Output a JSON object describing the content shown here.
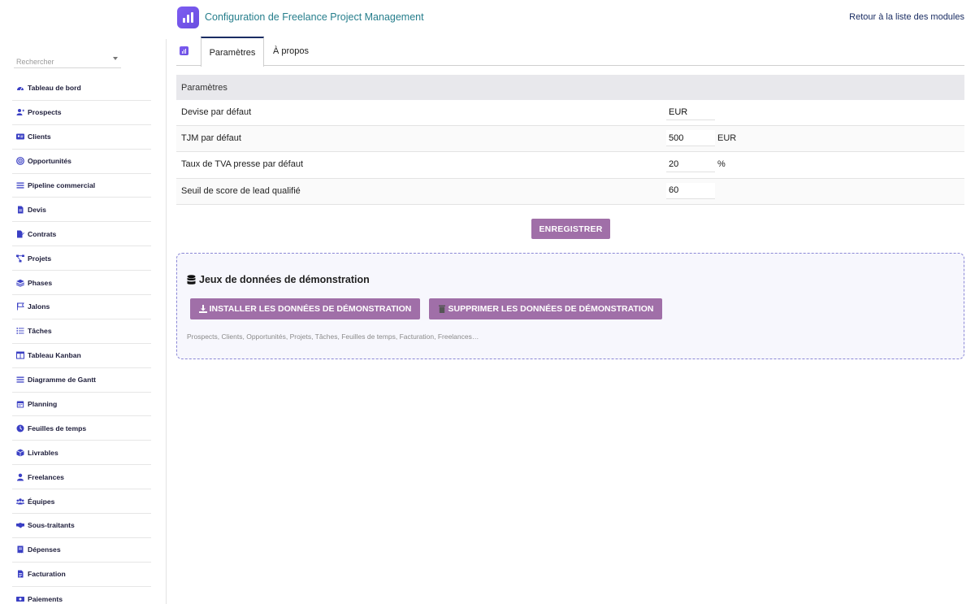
{
  "header": {
    "title": "Configuration de Freelance Project Management",
    "back_link": "Retour à la liste des modules"
  },
  "sidebar": {
    "search_placeholder": "Rechercher",
    "items": [
      {
        "label": "Tableau de bord",
        "icon": "gauge-icon"
      },
      {
        "label": "Prospects",
        "icon": "user-plus-icon"
      },
      {
        "label": "Clients",
        "icon": "id-card-icon"
      },
      {
        "label": "Opportunités",
        "icon": "target-icon"
      },
      {
        "label": "Pipeline commercial",
        "icon": "bars-icon"
      },
      {
        "label": "Devis",
        "icon": "file-icon"
      },
      {
        "label": "Contrats",
        "icon": "file-signature-icon"
      },
      {
        "label": "Projets",
        "icon": "project-diagram-icon"
      },
      {
        "label": "Phases",
        "icon": "layer-group-icon"
      },
      {
        "label": "Jalons",
        "icon": "flag-icon"
      },
      {
        "label": "Tâches",
        "icon": "tasks-icon"
      },
      {
        "label": "Tableau Kanban",
        "icon": "columns-icon"
      },
      {
        "label": "Diagramme de Gantt",
        "icon": "gantt-icon"
      },
      {
        "label": "Planning",
        "icon": "calendar-icon"
      },
      {
        "label": "Feuilles de temps",
        "icon": "clock-icon"
      },
      {
        "label": "Livrables",
        "icon": "box-icon"
      },
      {
        "label": "Freelances",
        "icon": "user-tie-icon"
      },
      {
        "label": "Équipes",
        "icon": "users-icon"
      },
      {
        "label": "Sous-traitants",
        "icon": "handshake-icon"
      },
      {
        "label": "Dépenses",
        "icon": "receipt-icon"
      },
      {
        "label": "Facturation",
        "icon": "invoice-icon"
      },
      {
        "label": "Paiements",
        "icon": "money-bill-icon"
      }
    ]
  },
  "tabs": [
    {
      "label": "Paramètres",
      "active": true
    },
    {
      "label": "À propos",
      "active": false
    }
  ],
  "settings": {
    "section_title": "Paramètres",
    "rows": [
      {
        "label": "Devise par défaut",
        "value": "EUR",
        "unit": ""
      },
      {
        "label": "TJM par défaut",
        "value": "500",
        "unit": "EUR"
      },
      {
        "label": "Taux de TVA presse par défaut",
        "value": "20",
        "unit": "%"
      },
      {
        "label": "Seuil de score de lead qualifié",
        "value": "60",
        "unit": ""
      }
    ],
    "save_label": "ENREGISTRER"
  },
  "demo": {
    "title": "Jeux de données de démonstration",
    "install_label": "INSTALLER LES DONNÉES DE DÉMONSTRATION",
    "delete_label": "SUPPRIMER LES DONNÉES DE DÉMONSTRATION",
    "description": "Prospects, Clients, Opportunités, Projets, Tâches, Feuilles de temps, Facturation, Freelances…"
  },
  "colors": {
    "accent": "#a06fa8",
    "icon_blue": "#3a3fc4",
    "title_teal": "#267e8c",
    "link_navy": "#1a2d63",
    "logo_purple": "#7d5cf2"
  }
}
